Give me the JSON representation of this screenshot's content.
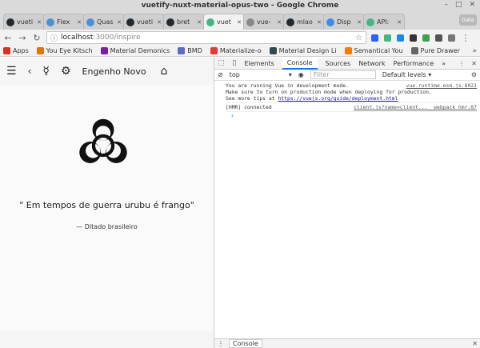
{
  "window": {
    "title": "vuetify-nuxt-material-opus-two - Google Chrome",
    "controls": [
      "–",
      "□",
      "✕"
    ]
  },
  "tabs": [
    {
      "label": "vueti",
      "color": "#24292e"
    },
    {
      "label": "Flex",
      "color": "#4a90d9"
    },
    {
      "label": "Quas",
      "color": "#4a90d9"
    },
    {
      "label": "vueti",
      "color": "#24292e"
    },
    {
      "label": "bret",
      "color": "#24292e"
    },
    {
      "label": "vuet",
      "color": "#41b883",
      "active": true
    },
    {
      "label": "vue-",
      "color": "#888888"
    },
    {
      "label": "mlao",
      "color": "#24292e"
    },
    {
      "label": "Disp",
      "color": "#3b8ee8"
    },
    {
      "label": "API:",
      "color": "#41b883"
    }
  ],
  "profile": "Gala",
  "url": {
    "host": "localhost",
    "path": ":3000/inspire"
  },
  "bookmarks": [
    {
      "label": "Apps",
      "color": "#d93025"
    },
    {
      "label": "You Eye Kitsch",
      "color": "#e37400"
    },
    {
      "label": "Material Demonics",
      "color": "#7b1fa2"
    },
    {
      "label": "BMD",
      "color": "#5c6bc0"
    },
    {
      "label": "Materialize-o",
      "color": "#e53935"
    },
    {
      "label": "Material Design Li",
      "color": "#37474f"
    },
    {
      "label": "Semantical You",
      "color": "#f57c00"
    },
    {
      "label": "Pure Drawer",
      "color": "#666666"
    }
  ],
  "app": {
    "title": "Engenho Novo ...",
    "quote": "\" Em tempos de guerra urubu é frango\"",
    "attribution": "— Ditado brasileiro"
  },
  "devtools": {
    "tabs": [
      "Elements",
      "Console",
      "Sources",
      "Network",
      "Performance"
    ],
    "active_tab": "Console",
    "context": "top",
    "filter_placeholder": "Filter",
    "levels": "Default levels ▾",
    "messages": [
      {
        "text": "You are running Vue in development mode.",
        "source": "vue.runtime.esm.js:8021"
      },
      {
        "text": "Make sure to turn on production mode when deploying for production.",
        "source": ""
      },
      {
        "text": "See more tips at ",
        "link": "https://vuejs.org/guide/deployment.html",
        "source": ""
      },
      {
        "text": "[HMR] connected",
        "source": "client.js?name=client...__webpack_hmr:87"
      }
    ],
    "drawer_tab": "Console"
  }
}
